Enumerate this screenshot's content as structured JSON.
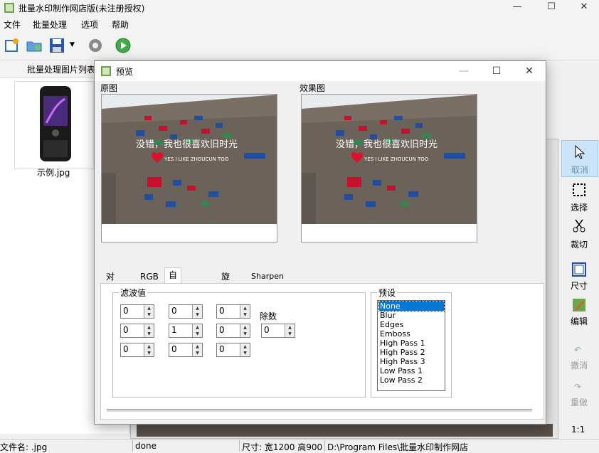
{
  "main": {
    "title": "批量水印制作网店版(未注册授权)",
    "minimize": "—",
    "maximize": "☐",
    "close": "✕",
    "menus": [
      "文件",
      "批量处理",
      "选项",
      "帮助"
    ],
    "list_header": "批量处理图片列表",
    "thumb_caption": "示例.jpg"
  },
  "right_panel": {
    "items": [
      {
        "label": "取消",
        "icon": "cursor-icon"
      },
      {
        "label": "选择",
        "icon": "select-rect-icon"
      },
      {
        "label": "裁切",
        "icon": "scissors-icon"
      },
      {
        "label": "尺寸",
        "icon": "resize-icon"
      },
      {
        "label": "编辑",
        "icon": "edit-icon"
      },
      {
        "label": "撤消",
        "icon": "undo-icon"
      },
      {
        "label": "重做",
        "icon": "redo-icon"
      }
    ],
    "zoom": "1:1"
  },
  "statusbar": {
    "filename": "文件名: .jpg",
    "status": "done",
    "size": "尺寸: 宽1200 高900",
    "path": "D:\\Program Files\\批量水印制作网店"
  },
  "dialog": {
    "title": "预览",
    "original_label": "原图",
    "result_label": "效果图",
    "photo_text": "没错，我也很喜欢旧时光",
    "photo_sub": "YES I LIKE ZHOUCUN TOO",
    "tabs": [
      "对比度",
      "RGB",
      "自定义过滤",
      "旋转",
      "Sharpen"
    ],
    "filter_group": "滤波值",
    "matrix": [
      [
        "0",
        "0",
        "0"
      ],
      [
        "0",
        "1",
        "0"
      ],
      [
        "0",
        "0",
        "0"
      ]
    ],
    "divisor_label": "除数",
    "divisor": "0",
    "preset_group": "预设",
    "presets": [
      "None",
      "Blur",
      "Edges",
      "Emboss",
      "High Pass 1",
      "High Pass 2",
      "High Pass 3",
      "Low Pass 1",
      "Low Pass 2"
    ],
    "selected_preset": "None"
  },
  "colors": {
    "accent": "#0078d7",
    "sign_red": "#c8102e",
    "sign_blue": "#1f4ea3",
    "wall": "#6b625a"
  }
}
